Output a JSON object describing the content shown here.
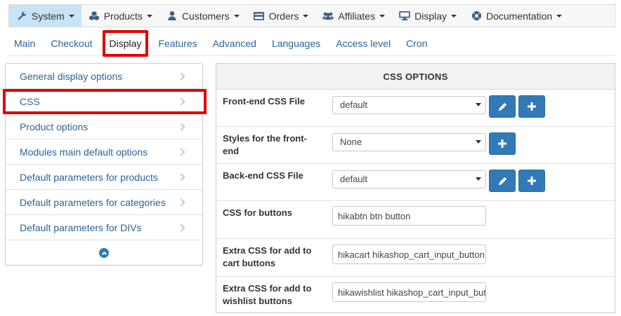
{
  "topmenu": {
    "items": [
      {
        "label": "System",
        "icon": "wrench-icon",
        "active": true
      },
      {
        "label": "Products",
        "icon": "cubes-icon"
      },
      {
        "label": "Customers",
        "icon": "user-icon"
      },
      {
        "label": "Orders",
        "icon": "credit-card-icon"
      },
      {
        "label": "Affiliates",
        "icon": "users-icon"
      },
      {
        "label": "Display",
        "icon": "monitor-icon"
      },
      {
        "label": "Documentation",
        "icon": "life-ring-icon"
      }
    ]
  },
  "tabs": {
    "items": [
      {
        "label": "Main"
      },
      {
        "label": "Checkout"
      },
      {
        "label": "Display",
        "active": true
      },
      {
        "label": "Features"
      },
      {
        "label": "Advanced"
      },
      {
        "label": "Languages"
      },
      {
        "label": "Access level"
      },
      {
        "label": "Cron"
      }
    ]
  },
  "sidebar": {
    "items": [
      {
        "label": "General display options"
      },
      {
        "label": "CSS",
        "highlight": true
      },
      {
        "label": "Product options"
      },
      {
        "label": "Modules main default options"
      },
      {
        "label": "Default parameters for products"
      },
      {
        "label": "Default parameters for categories"
      },
      {
        "label": "Default parameters for DIVs"
      }
    ]
  },
  "css_options": {
    "title": "CSS OPTIONS",
    "rows": [
      {
        "label": "Front-end CSS File",
        "type": "select",
        "value": "default",
        "buttons": [
          "edit",
          "add"
        ]
      },
      {
        "label": "Styles for the front-end",
        "type": "select",
        "value": "None",
        "buttons": [
          "add"
        ]
      },
      {
        "label": "Back-end CSS File",
        "type": "select",
        "value": "default",
        "buttons": [
          "edit",
          "add"
        ]
      },
      {
        "label": "CSS for buttons",
        "type": "input",
        "value": "hikabtn btn button"
      },
      {
        "label": "Extra CSS for add to cart buttons",
        "type": "input",
        "value": "hikacart hikashop_cart_input_button"
      },
      {
        "label": "Extra CSS for add to wishlist buttons",
        "type": "input",
        "value": "hikawishlist hikashop_cart_input_button"
      }
    ]
  },
  "colors": {
    "accent": "#3279b7",
    "highlight": "#e10000",
    "active_menu_bg": "#c7e3f5",
    "link": "#2a6496"
  }
}
